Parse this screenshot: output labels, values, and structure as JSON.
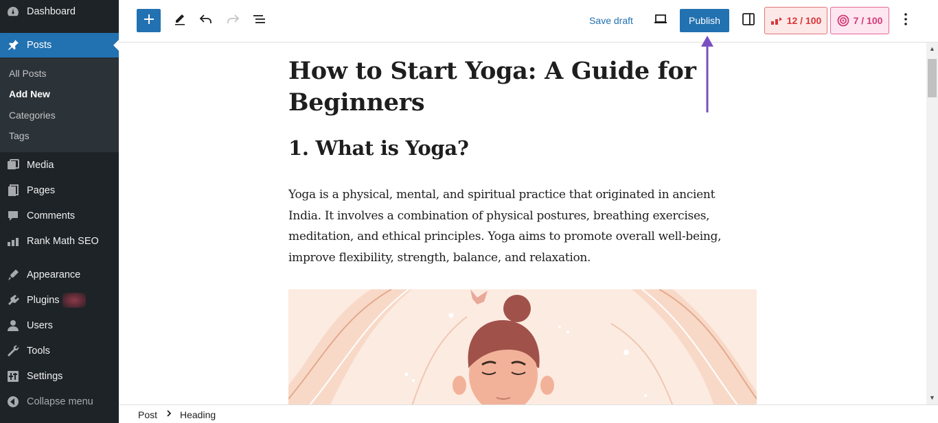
{
  "sidebar": {
    "dashboard": "Dashboard",
    "posts": "Posts",
    "submenu": [
      "All Posts",
      "Add New",
      "Categories",
      "Tags"
    ],
    "media": "Media",
    "pages": "Pages",
    "comments": "Comments",
    "rank_math": "Rank Math SEO",
    "appearance": "Appearance",
    "plugins": "Plugins",
    "users": "Users",
    "tools": "Tools",
    "settings": "Settings",
    "collapse": "Collapse menu"
  },
  "toolbar": {
    "save_draft": "Save draft",
    "publish": "Publish",
    "seo_score": "12 / 100",
    "readability_score": "7 / 100"
  },
  "editor": {
    "title": "How to Start Yoga: A Guide for Beginners",
    "heading": "1. What is Yoga?",
    "paragraph": "Yoga is a physical, mental, and spiritual practice that originated in ancient India. It involves a combination of physical postures, breathing exercises, meditation, and ethical principles. Yoga aims to promote overall well-being, improve flexibility, strength, balance, and relaxation."
  },
  "breadcrumb": [
    "Post",
    "Heading"
  ],
  "colors": {
    "accent": "#2271b1",
    "sidebar_bg": "#1d2327",
    "annotation_arrow": "#7b4fbf"
  },
  "icons": [
    "dashboard-icon",
    "pin-icon",
    "media-icon",
    "pages-icon",
    "comments-icon",
    "rank-math-icon",
    "appearance-icon",
    "plugins-icon",
    "users-icon",
    "tools-icon",
    "settings-icon",
    "collapse-icon",
    "plus-icon",
    "pencil-icon",
    "undo-icon",
    "redo-icon",
    "list-view-icon",
    "preview-icon",
    "sidebar-toggle-icon",
    "kebab-menu-icon"
  ]
}
